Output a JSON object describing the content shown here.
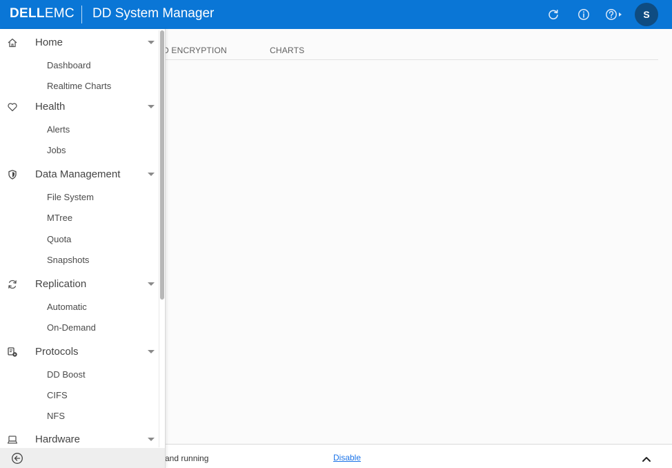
{
  "header": {
    "brand_dell": "DELL",
    "brand_emc": "EMC",
    "title": "DD System Manager",
    "avatar_initial": "S",
    "color": "#0a76d6"
  },
  "icons": {
    "refresh": "refresh-icon",
    "info": "info-icon",
    "help": "help-icon",
    "collapse": "arrow-left-circle-icon",
    "expand": "chevron-up-icon"
  },
  "main": {
    "tabs": [
      {
        "label": "D ENCRYPTION"
      },
      {
        "label": "CHARTS"
      }
    ]
  },
  "footer": {
    "status": "and running",
    "link": "Disable"
  },
  "sidebar": {
    "sections": [
      {
        "label": "Home",
        "icon": "home-icon",
        "items": [
          "Dashboard",
          "Realtime Charts"
        ]
      },
      {
        "label": "Health",
        "icon": "heart-icon",
        "items": [
          "Alerts",
          "Jobs"
        ]
      },
      {
        "label": "Data Management",
        "icon": "shield-icon",
        "items": [
          "File System",
          "MTree",
          "Quota",
          "Snapshots"
        ]
      },
      {
        "label": "Replication",
        "icon": "sync-icon",
        "items": [
          "Automatic",
          "On-Demand"
        ]
      },
      {
        "label": "Protocols",
        "icon": "protocols-icon",
        "items": [
          "DD Boost",
          "CIFS",
          "NFS"
        ]
      },
      {
        "label": "Hardware",
        "icon": "hardware-icon",
        "items": []
      }
    ]
  }
}
